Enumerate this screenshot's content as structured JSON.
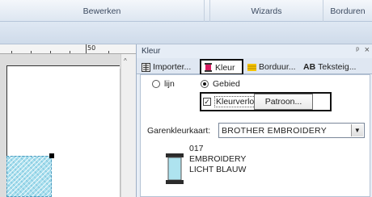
{
  "menubar": {
    "tabs": [
      {
        "label": "Bewerken"
      },
      {
        "label": "Wizards"
      },
      {
        "label": "Borduren"
      }
    ]
  },
  "ruler": {
    "mark_50": "50"
  },
  "panel": {
    "title": "Kleur",
    "pin_glyph": "ᵖ",
    "close_glyph": "×",
    "tabs": [
      {
        "label": "Importer...",
        "icon": "import-icon"
      },
      {
        "label": "Kleur",
        "icon": "color-spool-icon",
        "active": true
      },
      {
        "label": "Borduur...",
        "icon": "embroidery-icon"
      },
      {
        "label": "Teksteig...",
        "icon": "text-ab-icon",
        "icon_text": "AB"
      }
    ],
    "radios": [
      {
        "label": "lijn",
        "checked": false
      },
      {
        "label": "Gebied",
        "checked": true
      }
    ],
    "gradient_checkbox": {
      "label": "Kleurverloop",
      "checked": true,
      "mark": "✓"
    },
    "pattern_button": "Patroon...",
    "thread_chart_label": "Garenkleurkaart:",
    "thread_chart_value": "BROTHER EMBROIDERY",
    "thread": {
      "code": "017",
      "brand": "EMBROIDERY",
      "name": "LICHT BLAUW",
      "color": "#aee3ef"
    }
  },
  "colors": {
    "accent_border": "#111111",
    "embroidery_fill": "#a8dfee",
    "panel_bg": "#e8eef6"
  }
}
